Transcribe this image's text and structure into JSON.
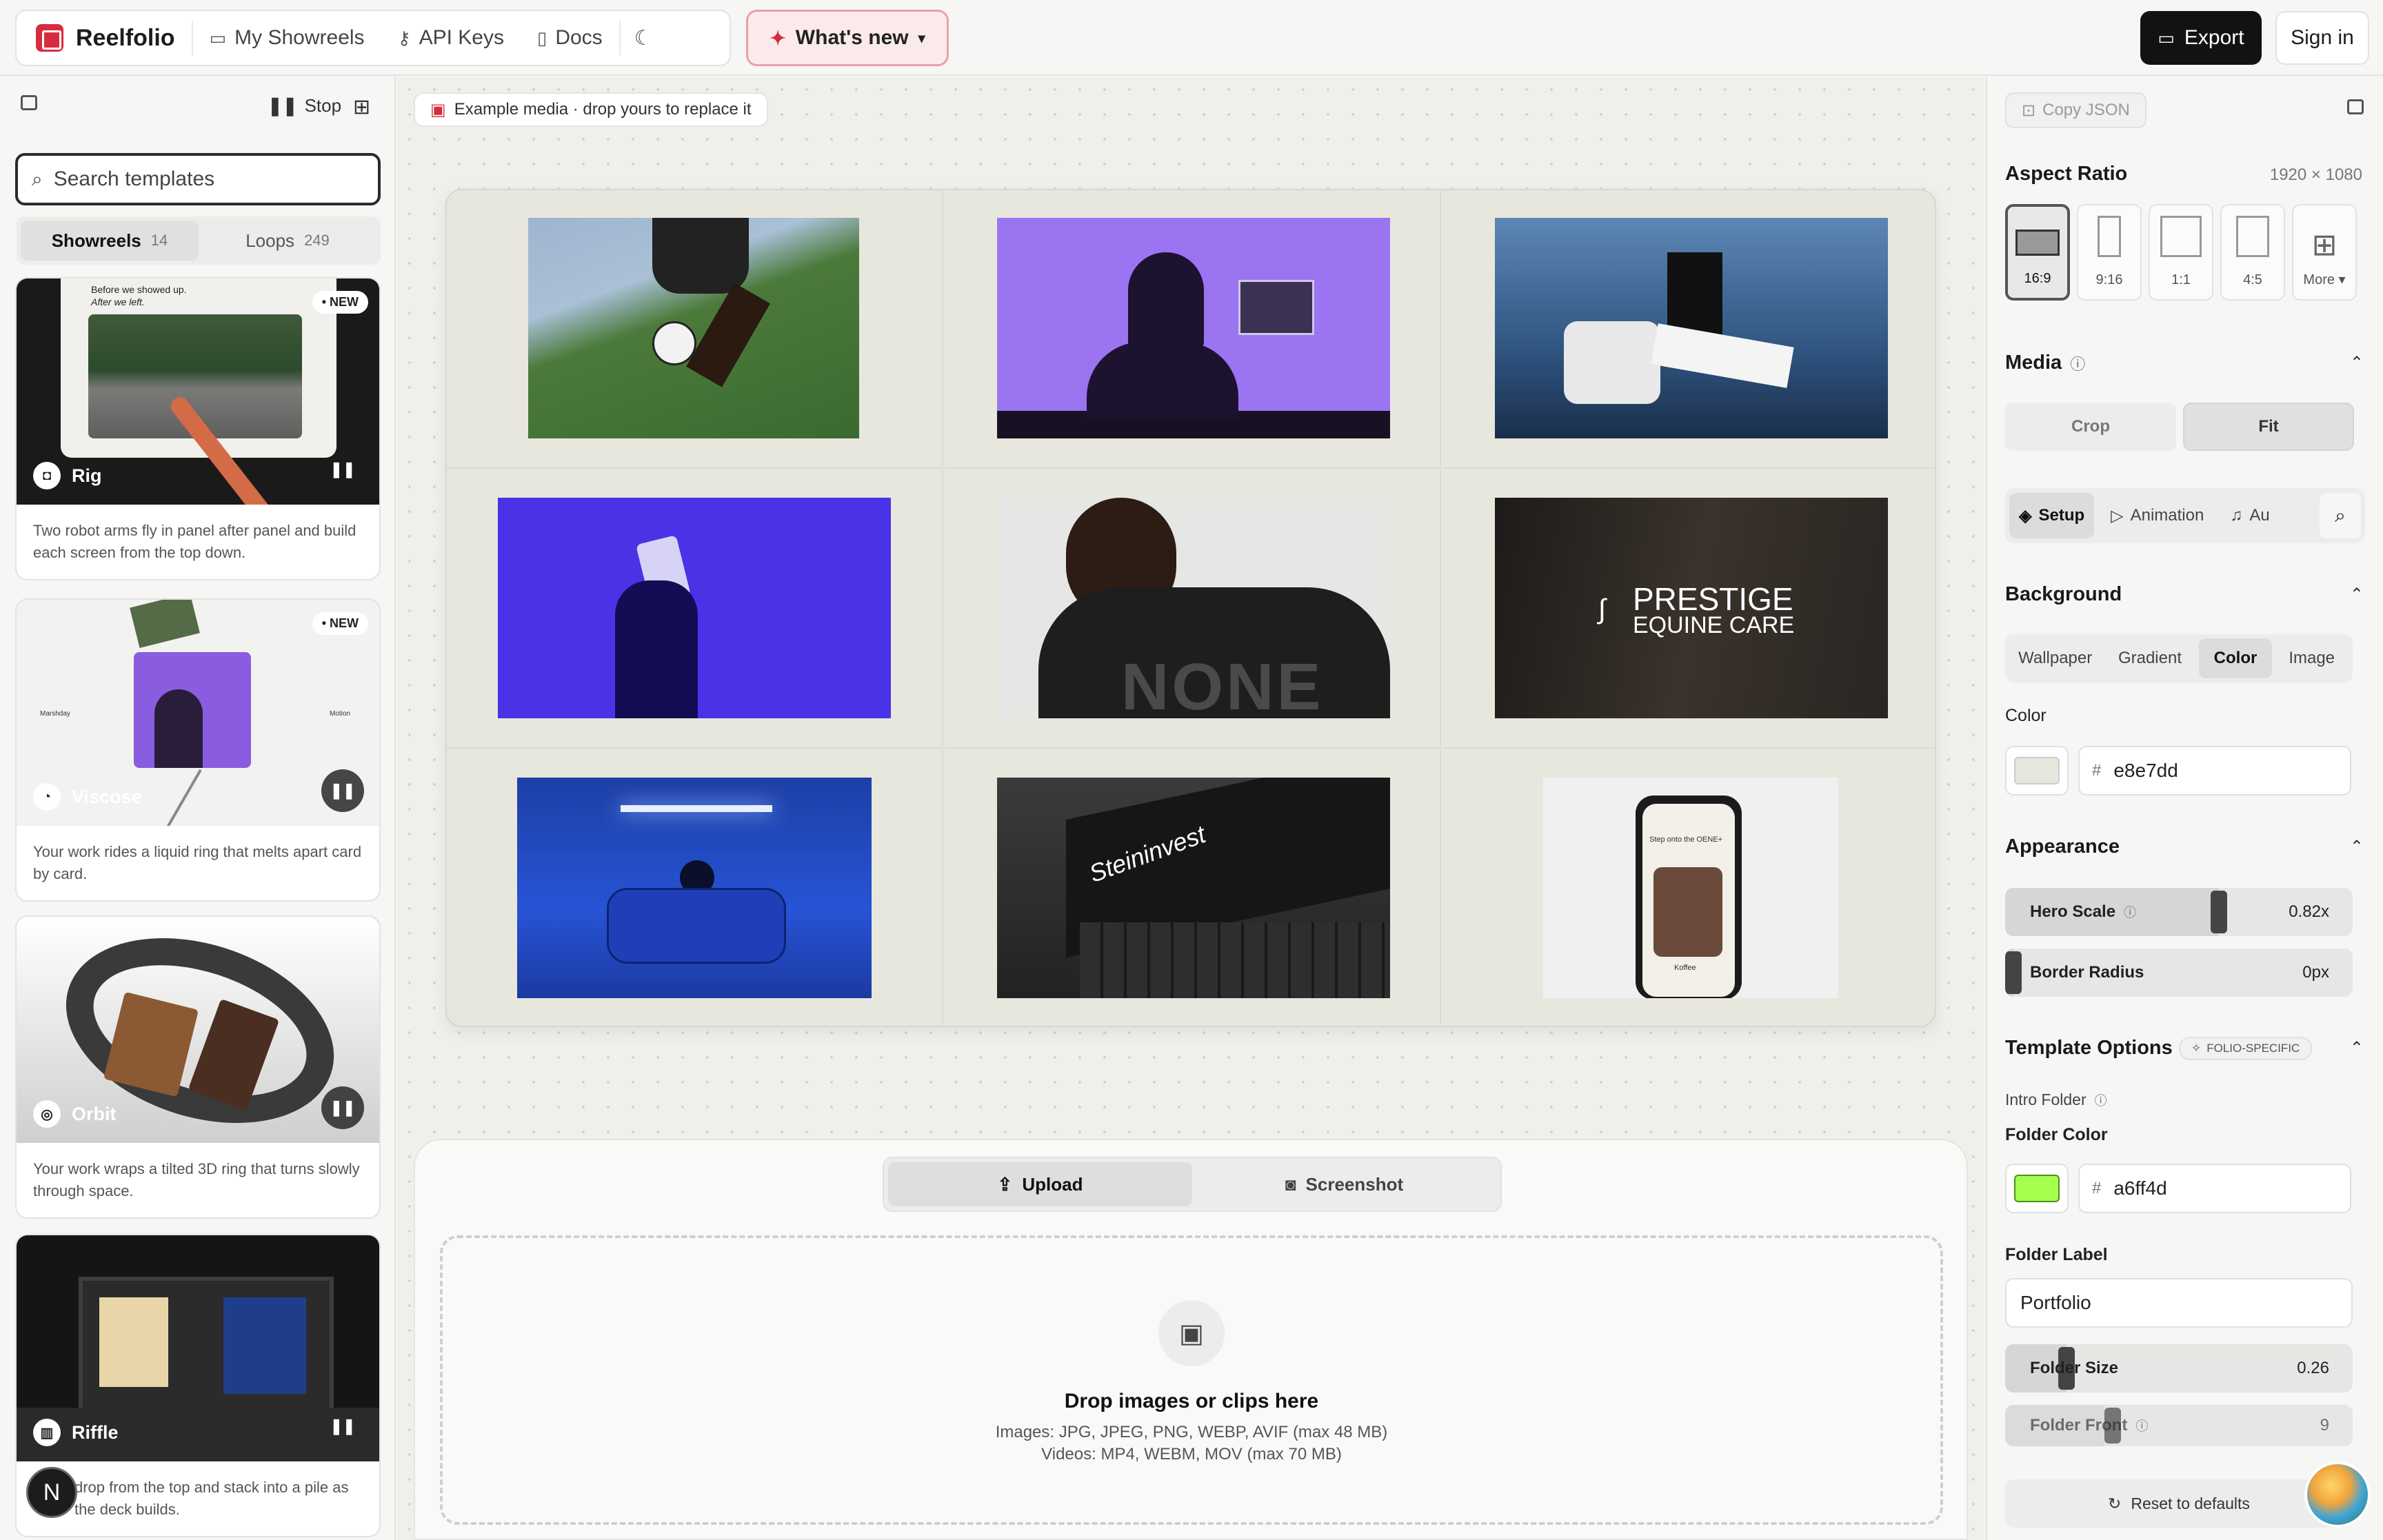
{
  "header": {
    "brand": "Reelfolio",
    "nav": [
      {
        "label": "My Showreels",
        "icon": "film-icon"
      },
      {
        "label": "API Keys",
        "icon": "key-icon"
      },
      {
        "label": "Docs",
        "icon": "book-icon"
      }
    ],
    "whats_new": "What's new",
    "export": "Export",
    "sign_in": "Sign in"
  },
  "sidebar": {
    "stop": "Stop",
    "search_placeholder": "Search templates",
    "tabs": [
      {
        "label": "Showreels",
        "count": "14"
      },
      {
        "label": "Loops",
        "count": "249"
      }
    ],
    "templates": [
      {
        "name": "Rig",
        "badge": "NEW",
        "caption": "Before we showed up.",
        "caption2": "After we left.",
        "description": "Two robot arms fly in panel after panel and build each screen from the top down."
      },
      {
        "name": "Viscose",
        "badge": "NEW",
        "left_tag": "Marshday",
        "right_tag": "Motion",
        "description": "Your work rides a liquid ring that melts apart card by card."
      },
      {
        "name": "Orbit",
        "description": "Your work wraps a tilted 3D ring that turns slowly through space."
      },
      {
        "name": "Riffle",
        "description": "drop from the top and stack into a pile as the deck builds."
      }
    ],
    "avatar_initial": "N"
  },
  "canvas": {
    "example_pill": "Example media · drop yours to replace it",
    "tile_texts": {
      "none": "NONE",
      "prestige_1": "PRESTIGE",
      "prestige_2": "EQUINE CARE",
      "steininvest": "Steininvest",
      "phone_top": "Step onto the OENE+",
      "phone_name": "Koffee"
    },
    "upload_tabs": [
      "Upload",
      "Screenshot"
    ],
    "drop_title": "Drop images or clips here",
    "drop_images": "Images: JPG, JPEG, PNG, WEBP, AVIF (max 48 MB)",
    "drop_videos": "Videos: MP4, WEBM, MOV (max 70 MB)"
  },
  "panel": {
    "copy_json": "Copy JSON",
    "aspect_ratio": {
      "title": "Aspect Ratio",
      "dims": "1920 × 1080",
      "options": [
        "16:9",
        "9:16",
        "1:1",
        "4:5",
        "More"
      ],
      "selected": "16:9"
    },
    "media": {
      "title": "Media",
      "options": [
        "Crop",
        "Fit"
      ],
      "selected": "Fit"
    },
    "subtabs": [
      "Setup",
      "Animation",
      "Au"
    ],
    "background": {
      "title": "Background",
      "options": [
        "Wallpaper",
        "Gradient",
        "Color",
        "Image"
      ],
      "selected": "Color",
      "color_label": "Color",
      "hash": "#",
      "color_value": "e8e7dd",
      "color_hex": "#e8e7dd"
    },
    "appearance": {
      "title": "Appearance",
      "hero_scale_label": "Hero Scale",
      "hero_scale_value": "0.82x",
      "hero_scale_fraction": 0.82,
      "border_radius_label": "Border Radius",
      "border_radius_value": "0px",
      "border_radius_fraction": 0
    },
    "template_options": {
      "title": "Template Options",
      "badge": "FOLIO-SPECIFIC",
      "intro_folder": "Intro Folder",
      "folder_color_label": "Folder Color",
      "folder_color_value": "a6ff4d",
      "folder_color_hex": "#a6ff4d",
      "folder_label_label": "Folder Label",
      "folder_label_value": "Portfolio",
      "folder_size_label": "Folder Size",
      "folder_size_value": "0.26",
      "folder_size_fraction": 0.26,
      "folder_front_label": "Folder Front",
      "folder_front_value": "9"
    },
    "reset": "Reset to defaults"
  }
}
